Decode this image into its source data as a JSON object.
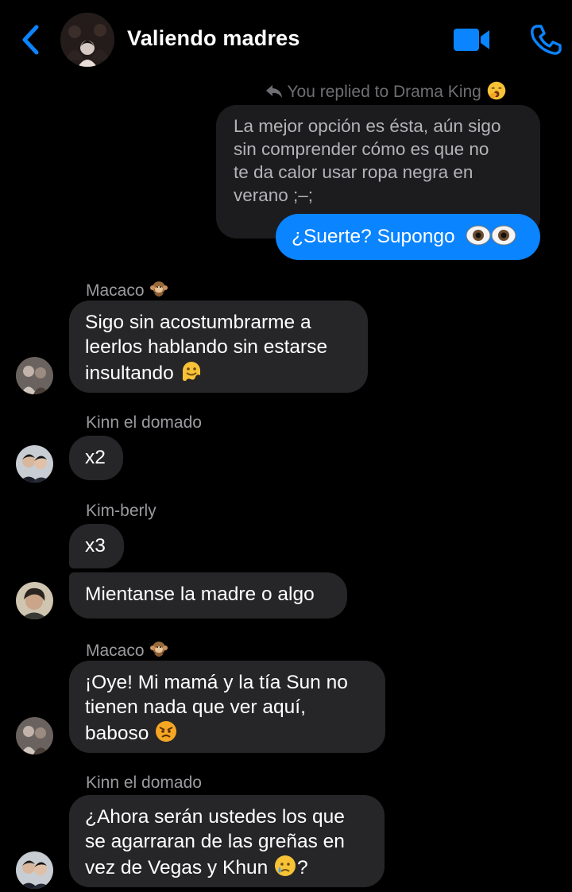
{
  "header": {
    "title": "Valiendo madres",
    "back_icon": "chevron-left-icon",
    "video_icon": "video-camera-icon",
    "call_icon": "phone-icon",
    "accent_color": "#0a84ff"
  },
  "reply": {
    "note": "You replied to Drama King",
    "quoted_text": "La mejor opción es ésta, aún sigo\nsin comprender cómo es que no\nte da calor usar ropa negra en\nverano ;–;",
    "my_message": "¿Suerte? Supongo"
  },
  "messages": [
    {
      "sender": "Macaco",
      "text": "Sigo sin acostumbrarme a\nleerlos hablando sin estarse\ninsultando"
    },
    {
      "sender": "Kinn el domado",
      "text": "x2"
    },
    {
      "sender": "Kim-berly",
      "text": "x3"
    },
    {
      "text": "Mientanse la madre o algo"
    },
    {
      "sender": "Macaco",
      "text": "¡Oye! Mi mamá y la tía Sun no\ntienen nada que ver aquí,\nbaboso"
    },
    {
      "sender": "Kinn el domado",
      "text": "¿Ahora serán ustedes los que\nse agarraran de las greñas en\nvez de Vegas y Khun",
      "suffix": "?"
    }
  ],
  "colors": {
    "background": "#000000",
    "incoming_bubble": "#262628",
    "quoted_bubble": "#1c1c1e",
    "outgoing_bubble": "#0a84ff",
    "meta_text": "#9a9a9f"
  }
}
